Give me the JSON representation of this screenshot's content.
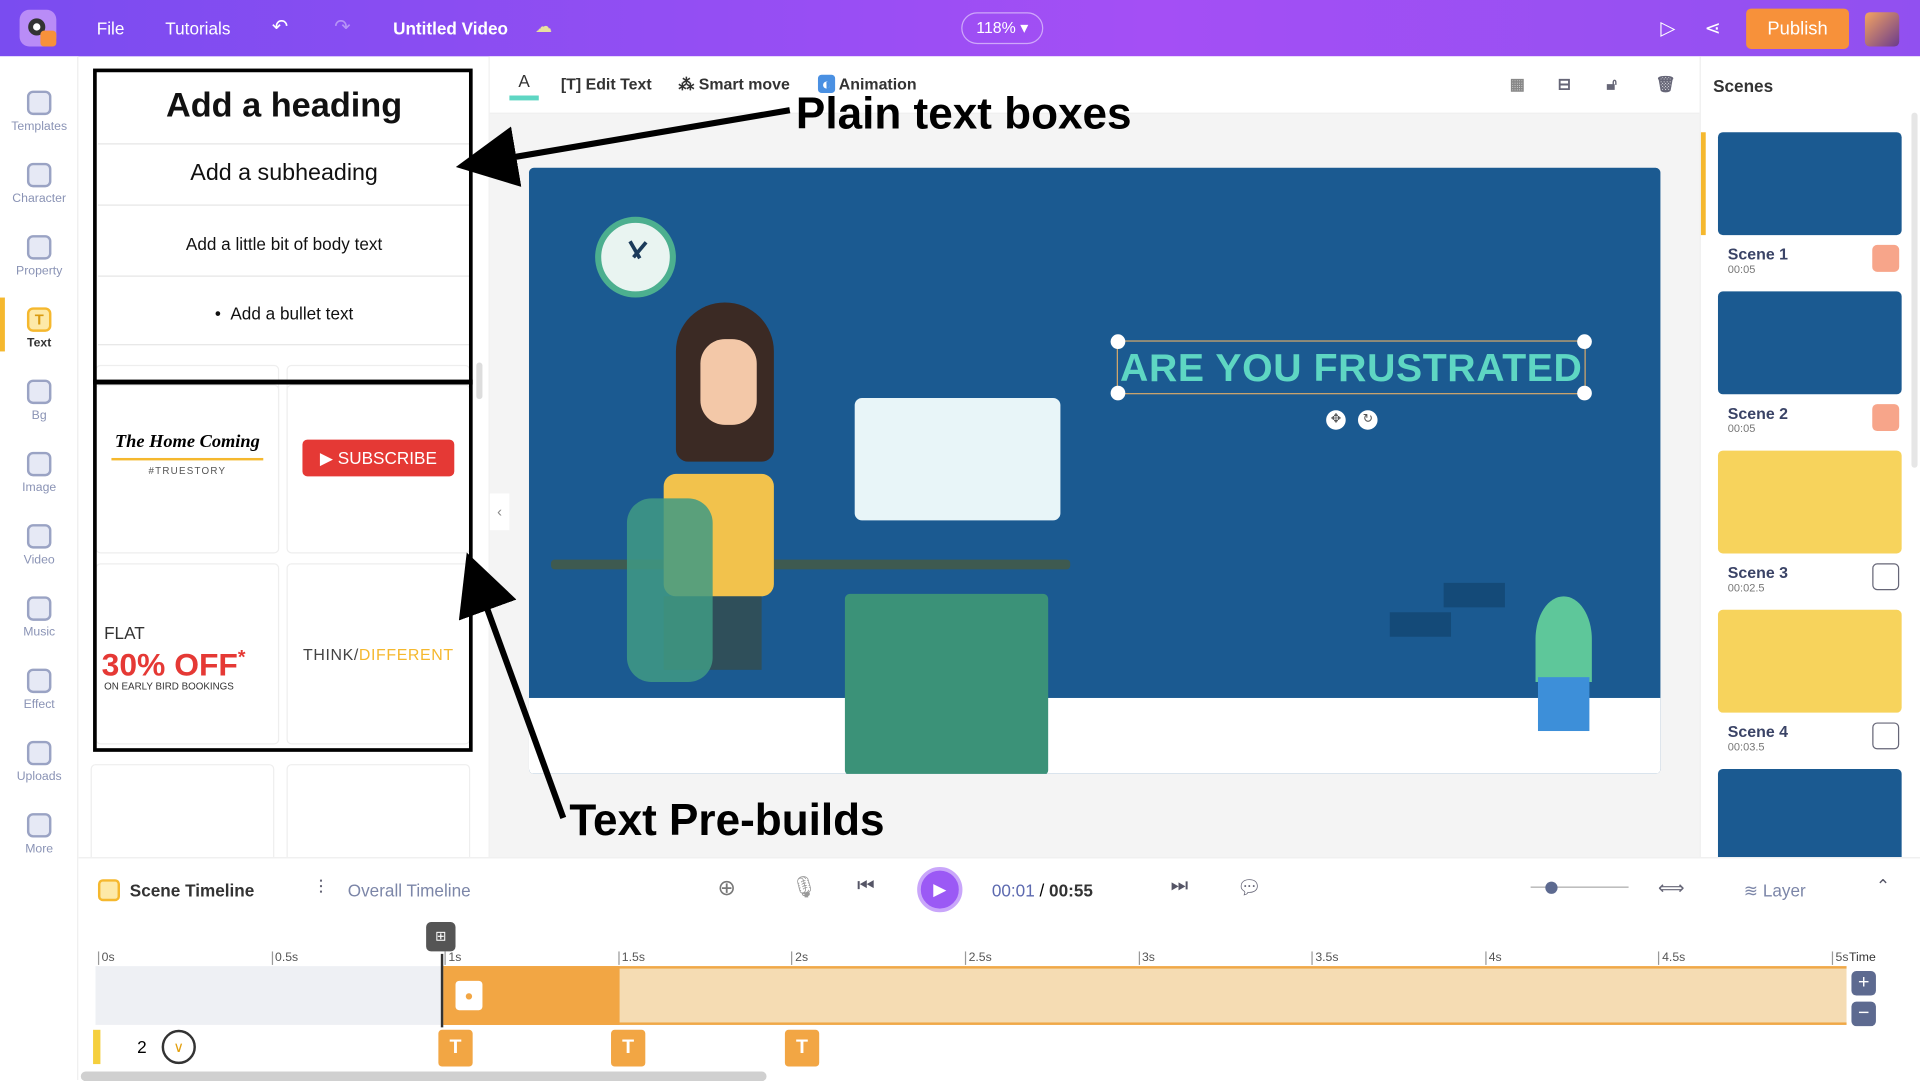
{
  "topbar": {
    "menu": [
      "File",
      "Tutorials"
    ],
    "title": "Untitled Video",
    "zoom": "118%",
    "publish": "Publish"
  },
  "rail": [
    {
      "label": "Templates"
    },
    {
      "label": "Character"
    },
    {
      "label": "Property"
    },
    {
      "label": "Text",
      "active": true
    },
    {
      "label": "Bg"
    },
    {
      "label": "Image"
    },
    {
      "label": "Video"
    },
    {
      "label": "Music"
    },
    {
      "label": "Effect"
    },
    {
      "label": "Uploads"
    },
    {
      "label": "More"
    }
  ],
  "panel": {
    "heading": "Add a heading",
    "subheading": "Add a subheading",
    "body": "Add a little bit of body text",
    "bullet": "Add a bullet text",
    "prebuilds": {
      "homecoming_title": "The Home Coming",
      "homecoming_tag": "#TRUESTORY",
      "subscribe": "SUBSCRIBE",
      "flat": "FLAT",
      "off": "30% OFF",
      "asterisk": "*",
      "early": "ON EARLY BIRD BOOKINGS",
      "think": "THINK/",
      "different": "DIFFERENT"
    }
  },
  "toolbar": {
    "edit_text": "Edit Text",
    "smart_move": "Smart move",
    "animation": "Animation"
  },
  "canvas": {
    "headline": "ARE YOU FRUSTRATED",
    "bg_color": "#1b5a91",
    "text_color": "#5ed6c3"
  },
  "scenes": {
    "title": "Scenes",
    "items": [
      {
        "name": "Scene 1",
        "duration": "00:05",
        "color": "#1b5a91"
      },
      {
        "name": "Scene 2",
        "duration": "00:05",
        "color": "#1b5a91"
      },
      {
        "name": "Scene 3",
        "duration": "00:02.5",
        "color": "#f7d35c"
      },
      {
        "name": "Scene 4",
        "duration": "00:03.5",
        "color": "#f7d35c"
      },
      {
        "name": "",
        "duration": "",
        "color": "#1b5a91"
      }
    ]
  },
  "timeline": {
    "scene_tab": "Scene Timeline",
    "overall_tab": "Overall Timeline",
    "current": "00:01",
    "separator": "/",
    "total": "00:55",
    "layer": "Layer",
    "time_label": "Time",
    "ticks": [
      "0s",
      "0.5s",
      "1s",
      "1.5s",
      "2s",
      "2.5s",
      "3s",
      "3.5s",
      "4s",
      "4.5s",
      "5s"
    ],
    "layer_num": "2",
    "text_marker": "T"
  },
  "annotations": {
    "plain": "Plain text boxes",
    "prebuilds": "Text Pre-builds"
  }
}
